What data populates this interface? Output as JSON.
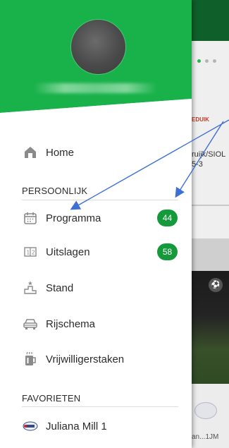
{
  "background": {
    "match_text": [
      "ruijk/SIOL",
      "5-3"
    ],
    "club_text": "an...1JM",
    "logo_text": "EDUIK"
  },
  "drawer": {
    "brand_color": "#19b24a",
    "menu": [
      {
        "label": "Home",
        "icon": "home-icon"
      },
      {
        "label": "Programma",
        "icon": "calendar-icon",
        "badge": "44"
      },
      {
        "label": "Uitslagen",
        "icon": "scoreboard-icon",
        "badge": "58"
      },
      {
        "label": "Stand",
        "icon": "podium-icon"
      },
      {
        "label": "Rijschema",
        "icon": "car-icon"
      },
      {
        "label": "Vrijwilligerstaken",
        "icon": "beer-mug-icon"
      },
      {
        "label": "Juliana Mill 1",
        "icon": "club-logo-icon"
      }
    ],
    "sections": {
      "personal": "PERSOONLIJK",
      "favorites": "FAVORIETEN"
    },
    "badge_color": "#149a3b",
    "annotation_color": "#3d6fd6"
  }
}
